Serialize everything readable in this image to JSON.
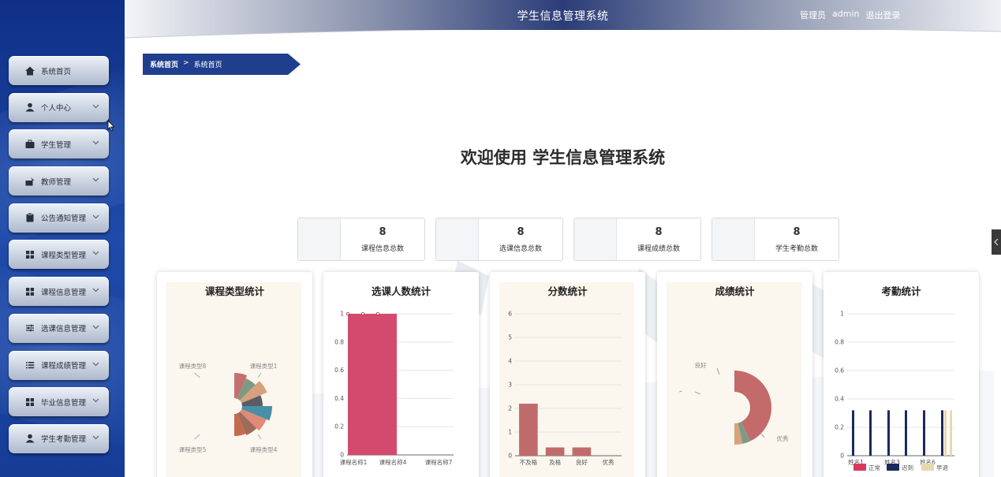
{
  "header": {
    "title": "学生信息管理系统",
    "role": "管理员",
    "username": "admin",
    "logout": "退出登录"
  },
  "sidebar": {
    "items": [
      {
        "label": "系统首页",
        "icon": "home-icon",
        "expandable": false
      },
      {
        "label": "个人中心",
        "icon": "user-icon",
        "expandable": true
      },
      {
        "label": "学生管理",
        "icon": "briefcase-icon",
        "expandable": true
      },
      {
        "label": "教师管理",
        "icon": "teacher-icon",
        "expandable": true
      },
      {
        "label": "公告通知管理",
        "icon": "clipboard-icon",
        "expandable": true
      },
      {
        "label": "课程类型管理",
        "icon": "grid-icon",
        "expandable": true
      },
      {
        "label": "课程信息管理",
        "icon": "grid-icon",
        "expandable": true
      },
      {
        "label": "选课信息管理",
        "icon": "sliders-icon",
        "expandable": true
      },
      {
        "label": "课程成绩管理",
        "icon": "list-icon",
        "expandable": true
      },
      {
        "label": "毕业信息管理",
        "icon": "grid-icon",
        "expandable": true
      },
      {
        "label": "学生考勤管理",
        "icon": "user-icon",
        "expandable": true
      }
    ]
  },
  "breadcrumb": {
    "root": "系统首页",
    "separator": ">",
    "current": "系统首页"
  },
  "welcome": "欢迎使用 学生信息管理系统",
  "stats": [
    {
      "value": "8",
      "label": "课程信息总数"
    },
    {
      "value": "8",
      "label": "选课信息总数"
    },
    {
      "value": "8",
      "label": "课程成绩总数"
    },
    {
      "value": "8",
      "label": "学生考勤总数"
    }
  ],
  "colors": {
    "sidebar_dark": "#0f2f86",
    "bar_red": "#d44a6e",
    "bar_muted": "#c06b6b",
    "attendance_navy": "#1a2a5c",
    "attendance_tan": "#e8d8b0",
    "card_bg_warm": "#fbf6ee"
  },
  "chart_data": [
    {
      "type": "pie",
      "title": "课程类型统计",
      "labels": [
        "课程类型1",
        "课程类型4",
        "课程类型5",
        "课程类型8"
      ],
      "values": [
        1,
        1,
        1,
        1,
        1,
        1,
        1,
        1
      ]
    },
    {
      "type": "bar",
      "title": "选课人数统计",
      "categories": [
        "课程名称1",
        "课程名称4",
        "课程名称7"
      ],
      "values": [
        1,
        0,
        0
      ],
      "ylim": [
        0,
        1
      ],
      "yticks": [
        "0",
        "0.2",
        "0.4",
        "0.6",
        "0.8",
        "1"
      ],
      "grid": true
    },
    {
      "type": "bar",
      "title": "分数统计",
      "categories": [
        "不及格",
        "及格",
        "良好",
        "优秀"
      ],
      "values": [
        2.2,
        0.35,
        0.35,
        0
      ],
      "ylim": [
        0,
        6
      ],
      "yticks": [
        "0",
        "1",
        "2",
        "3",
        "4",
        "5",
        "6"
      ],
      "grid": true
    },
    {
      "type": "pie",
      "title": "成绩统计",
      "labels": [
        "良好",
        "优秀"
      ],
      "values": [
        6,
        0.5,
        0.5
      ]
    },
    {
      "type": "bar",
      "title": "考勤统计",
      "categories": [
        "姓名1",
        "姓名3",
        "姓名6"
      ],
      "yticks": [
        "0",
        "0.2",
        "0.4",
        "0.6",
        "0.8",
        "1"
      ],
      "ylim": [
        0,
        1
      ],
      "grid": true,
      "series": [
        {
          "name": "正常",
          "values": [
            0.32,
            0.32,
            0.32
          ]
        },
        {
          "name": "迟到",
          "values": [
            0.32,
            0.32,
            0.32
          ]
        },
        {
          "name": "早退",
          "values": [
            0,
            0,
            0.32
          ]
        }
      ]
    }
  ]
}
